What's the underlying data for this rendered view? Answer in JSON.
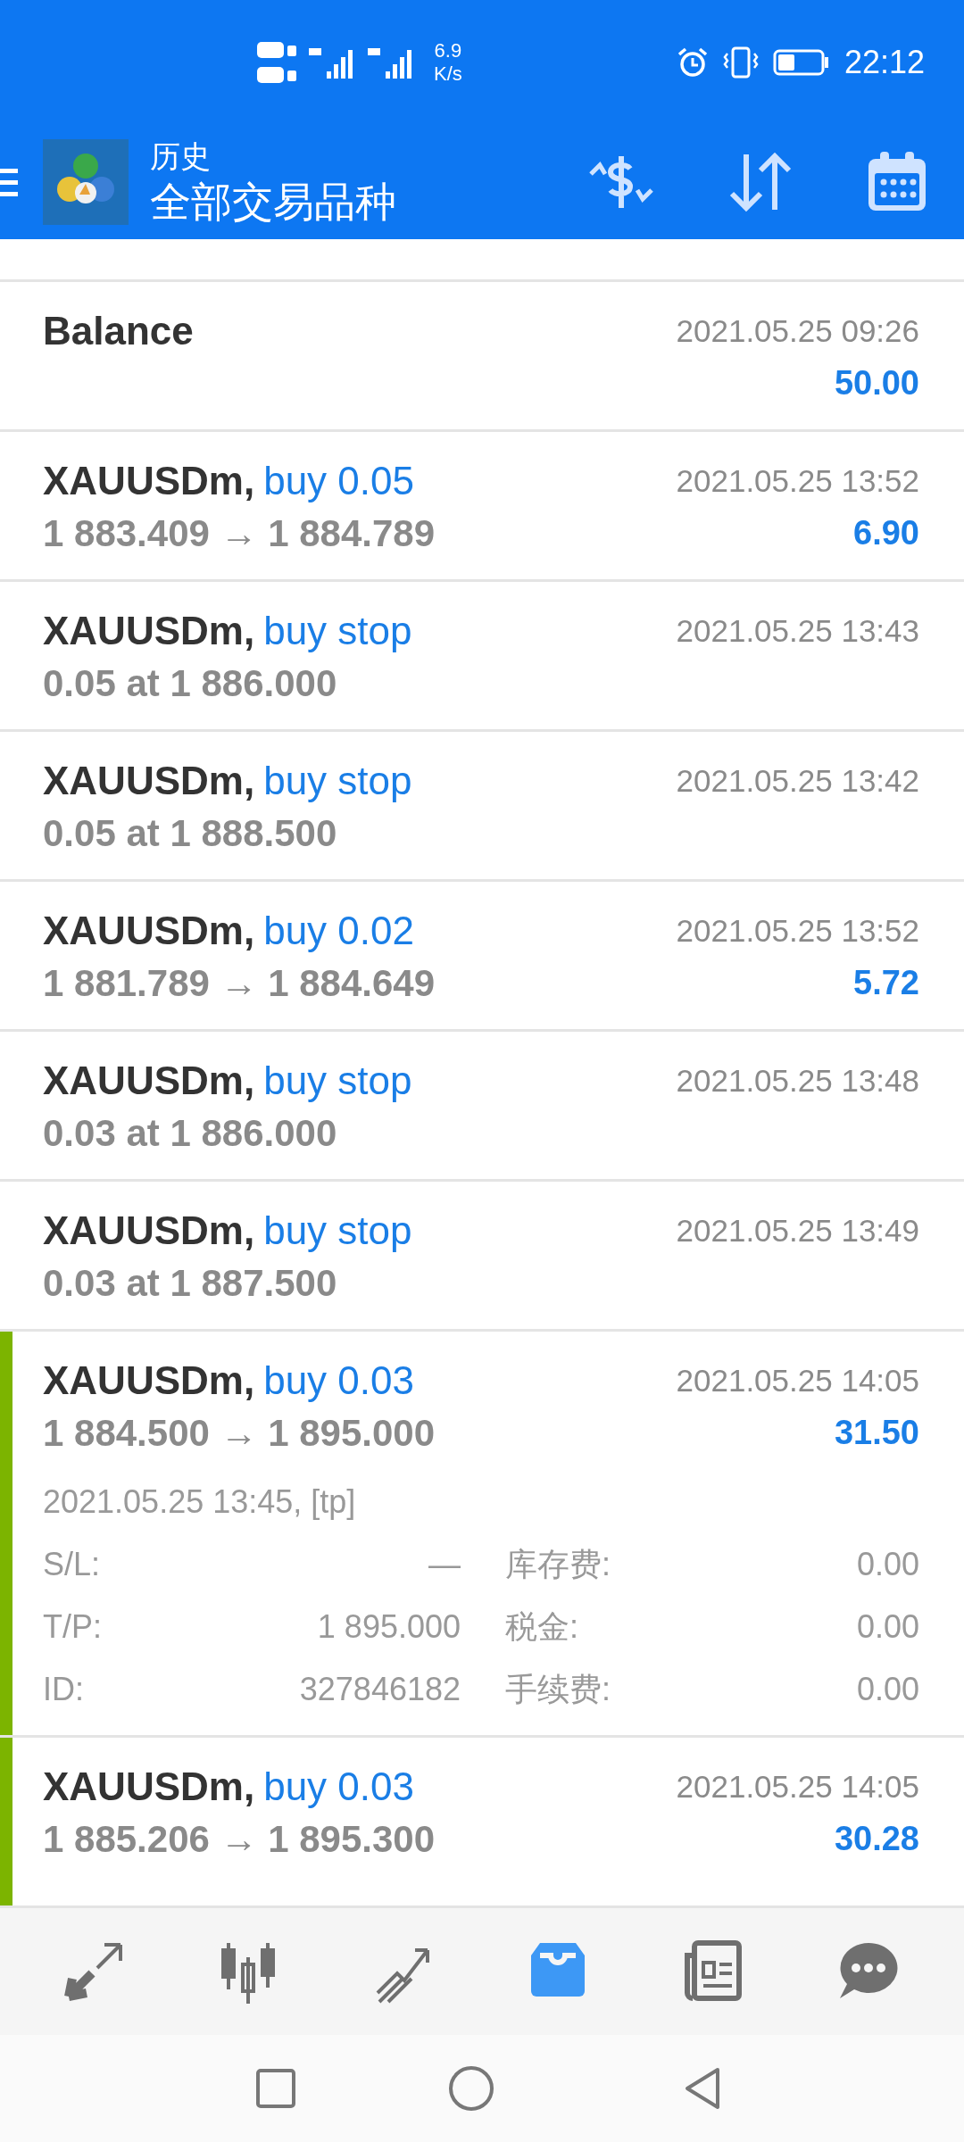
{
  "status_bar": {
    "speed_value": "6.9",
    "speed_unit": "K/s",
    "time": "22:12"
  },
  "header": {
    "title": "历史",
    "subtitle": "全部交易品种"
  },
  "rows": [
    {
      "kind": "balance",
      "title": "Balance",
      "time": "2021.05.25 09:26",
      "amount": "50.00",
      "expanded": false
    },
    {
      "kind": "deal",
      "symbol": "XAUUSDm,",
      "action": "buy 0.05",
      "prices": "1 883.409 → 1 884.789",
      "time": "2021.05.25 13:52",
      "amount": "6.90",
      "expanded": false
    },
    {
      "kind": "order",
      "symbol": "XAUUSDm,",
      "action": "buy stop",
      "prices": "0.05 at 1 886.000",
      "time": "2021.05.25 13:43",
      "expanded": false
    },
    {
      "kind": "order",
      "symbol": "XAUUSDm,",
      "action": "buy stop",
      "prices": "0.05 at 1 888.500",
      "time": "2021.05.25 13:42",
      "expanded": false
    },
    {
      "kind": "deal",
      "symbol": "XAUUSDm,",
      "action": "buy 0.02",
      "prices": "1 881.789 → 1 884.649",
      "time": "2021.05.25 13:52",
      "amount": "5.72",
      "expanded": false
    },
    {
      "kind": "order",
      "symbol": "XAUUSDm,",
      "action": "buy stop",
      "prices": "0.03 at 1 886.000",
      "time": "2021.05.25 13:48",
      "expanded": false
    },
    {
      "kind": "order",
      "symbol": "XAUUSDm,",
      "action": "buy stop",
      "prices": "0.03 at 1 887.500",
      "time": "2021.05.25 13:49",
      "expanded": false
    },
    {
      "kind": "deal",
      "symbol": "XAUUSDm,",
      "action": "buy 0.03",
      "prices": "1 884.500 → 1 895.000",
      "time": "2021.05.25 14:05",
      "amount": "31.50",
      "expanded": true,
      "open_time": "2021.05.25 13:45, [tp]",
      "details": [
        {
          "label": "S/L:",
          "value": "—",
          "label2": "库存费:",
          "value2": "0.00"
        },
        {
          "label": "T/P:",
          "value": "1 895.000",
          "label2": "税金:",
          "value2": "0.00"
        },
        {
          "label": "ID:",
          "value": "327846182",
          "label2": "手续费:",
          "value2": "0.00"
        }
      ]
    },
    {
      "kind": "deal",
      "symbol": "XAUUSDm,",
      "action": "buy 0.03",
      "prices": "1 885.206 → 1 895.300",
      "time": "2021.05.25 14:05",
      "amount": "30.28",
      "expanded": true
    }
  ],
  "bottom_nav": [
    {
      "selected": false
    },
    {
      "selected": false
    },
    {
      "selected": false
    },
    {
      "selected": true
    },
    {
      "selected": false
    },
    {
      "selected": false
    }
  ]
}
